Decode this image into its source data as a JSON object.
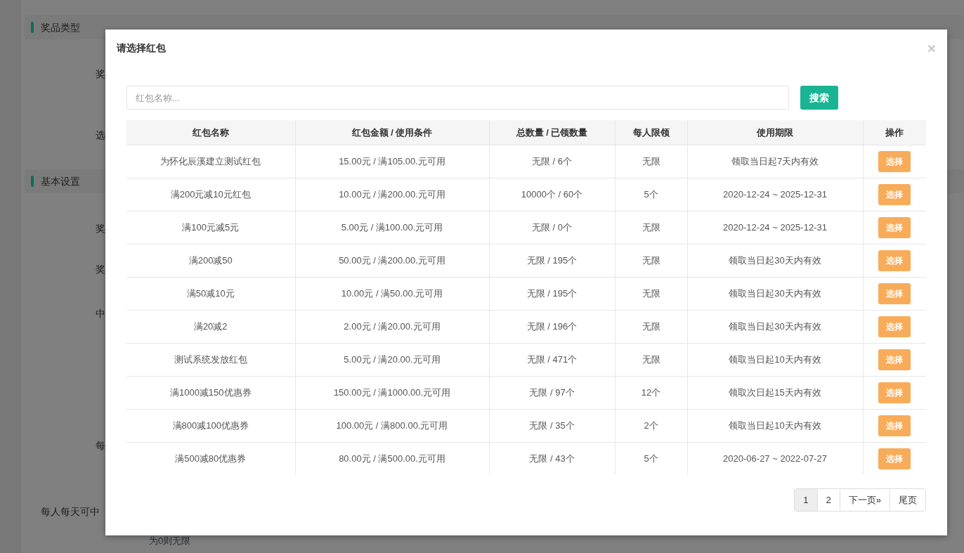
{
  "background": {
    "sections": [
      {
        "title": "奖品类型",
        "fields": [
          "奖",
          "选"
        ]
      },
      {
        "title": "基本设置",
        "fields": [
          "奖",
          "奖",
          "中",
          "每",
          "每人每天可中"
        ],
        "help": "为0则无限"
      }
    ]
  },
  "modal": {
    "title": "请选择红包",
    "close": "×",
    "search": {
      "placeholder": "红包名称...",
      "button": "搜索"
    },
    "table": {
      "columns": [
        "红包名称",
        "红包金额 / 使用条件",
        "总数量 / 已领数量",
        "每人限领",
        "使用期限",
        "操作"
      ],
      "rows": [
        {
          "cells": [
            "为怀化辰溪建立测试红包",
            "15.00元 / 满105.00.元可用",
            "无限 / 6个",
            "无限",
            "领取当日起7天内有效"
          ],
          "action": "选择"
        },
        {
          "cells": [
            "满200元减10元红包",
            "10.00元 / 满200.00.元可用",
            "10000个 / 60个",
            "5个",
            "2020-12-24 ~ 2025-12-31"
          ],
          "action": "选择"
        },
        {
          "cells": [
            "满100元减5元",
            "5.00元 / 满100.00.元可用",
            "无限 / 0个",
            "无限",
            "2020-12-24 ~ 2025-12-31"
          ],
          "action": "选择"
        },
        {
          "cells": [
            "满200减50",
            "50.00元 / 满200.00.元可用",
            "无限 / 195个",
            "无限",
            "领取当日起30天内有效"
          ],
          "action": "选择"
        },
        {
          "cells": [
            "满50减10元",
            "10.00元 / 满50.00.元可用",
            "无限 / 195个",
            "无限",
            "领取当日起30天内有效"
          ],
          "action": "选择"
        },
        {
          "cells": [
            "满20减2",
            "2.00元 / 满20.00.元可用",
            "无限 / 196个",
            "无限",
            "领取当日起30天内有效"
          ],
          "action": "选择"
        },
        {
          "cells": [
            "测试系统发放红包",
            "5.00元 / 满20.00.元可用",
            "无限 / 471个",
            "无限",
            "领取当日起10天内有效"
          ],
          "action": "选择"
        },
        {
          "cells": [
            "满1000减150优惠券",
            "150.00元 / 满1000.00.元可用",
            "无限 / 97个",
            "12个",
            "领取次日起15天内有效"
          ],
          "action": "选择"
        },
        {
          "cells": [
            "满800减100优惠券",
            "100.00元 / 满800.00.元可用",
            "无限 / 35个",
            "2个",
            "领取当日起10天内有效"
          ],
          "action": "选择"
        },
        {
          "cells": [
            "满500减80优惠券",
            "80.00元 / 满500.00.元可用",
            "无限 / 43个",
            "5个",
            "2020-06-27 ~ 2022-07-27"
          ],
          "action": "选择"
        }
      ]
    },
    "pagination": [
      {
        "label": "1",
        "selected": true
      },
      {
        "label": "2",
        "selected": false
      },
      {
        "label": "下一页»",
        "selected": false
      },
      {
        "label": "尾页",
        "selected": false
      }
    ]
  }
}
